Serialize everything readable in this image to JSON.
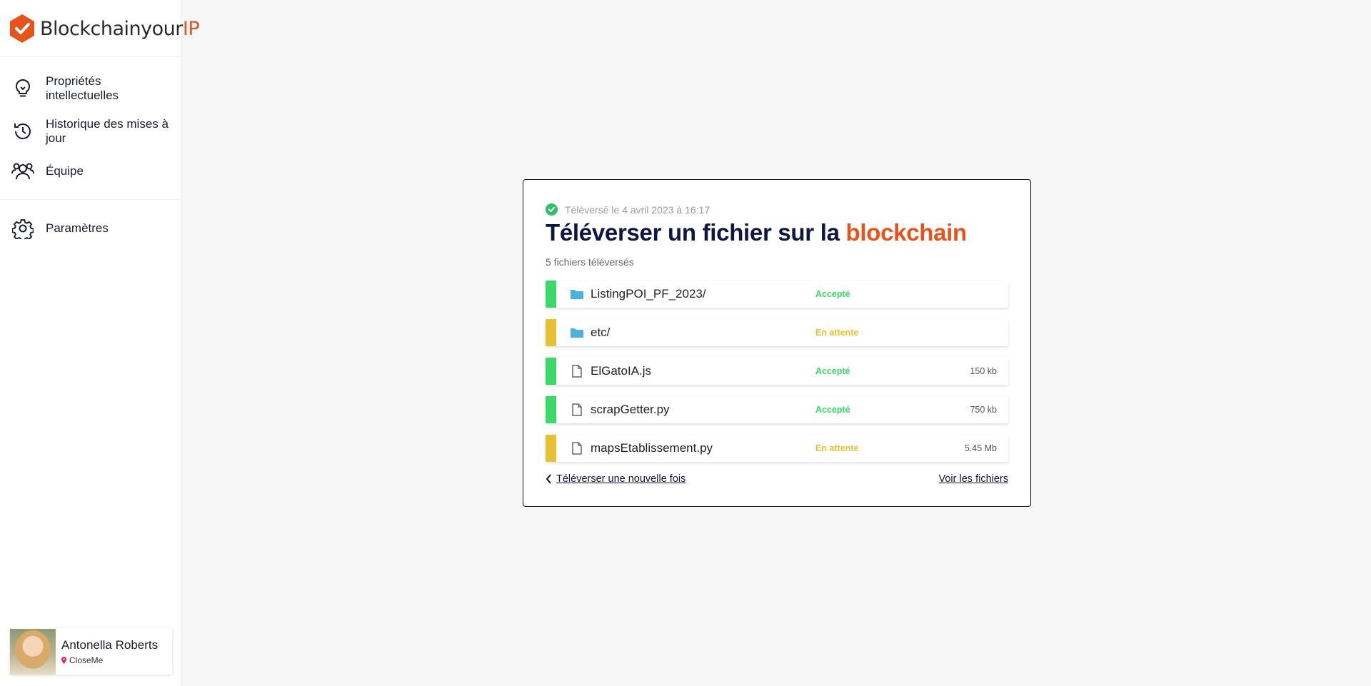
{
  "brand": {
    "name_main": "Blockchainyour",
    "name_accent": "IP",
    "accent_color": "#e8531c"
  },
  "sidebar": {
    "items": [
      {
        "label": "Propriétés intellectuelles",
        "icon": "lightbulb-icon"
      },
      {
        "label": "Historique des mises à jour",
        "icon": "history-icon"
      },
      {
        "label": "Équipe",
        "icon": "team-icon"
      },
      {
        "label": "Paramètres",
        "icon": "gear-icon"
      }
    ]
  },
  "profile": {
    "name": "Antonella Roberts",
    "org": "CloseMe"
  },
  "card": {
    "uploaded_at": "Téléversé le 4 avril 2023 à 16:17",
    "title_main": "Téléverser un fichier sur la ",
    "title_accent": "blockchain",
    "count_label": "5 fichiers téléversés",
    "files": [
      {
        "name": "ListingPOI_PF_2023/",
        "type": "folder",
        "status": "Accepté",
        "size": "",
        "status_color": "#3dd86a"
      },
      {
        "name": "etc/",
        "type": "folder",
        "status": "En attente",
        "size": "",
        "status_color": "#e6c232"
      },
      {
        "name": "ElGatoIA.js",
        "type": "file",
        "status": "Accepté",
        "size": "150 kb",
        "status_color": "#3dd86a"
      },
      {
        "name": "scrapGetter.py",
        "type": "file",
        "status": "Accepté",
        "size": "750 kb",
        "status_color": "#3dd86a"
      },
      {
        "name": "mapsEtablissement.py",
        "type": "file",
        "status": "En attente",
        "size": "5.45 Mb",
        "status_color": "#e6c232"
      }
    ],
    "back_label": "Téléverser une nouvelle fois",
    "see_files_label": "Voir les fichiers"
  }
}
